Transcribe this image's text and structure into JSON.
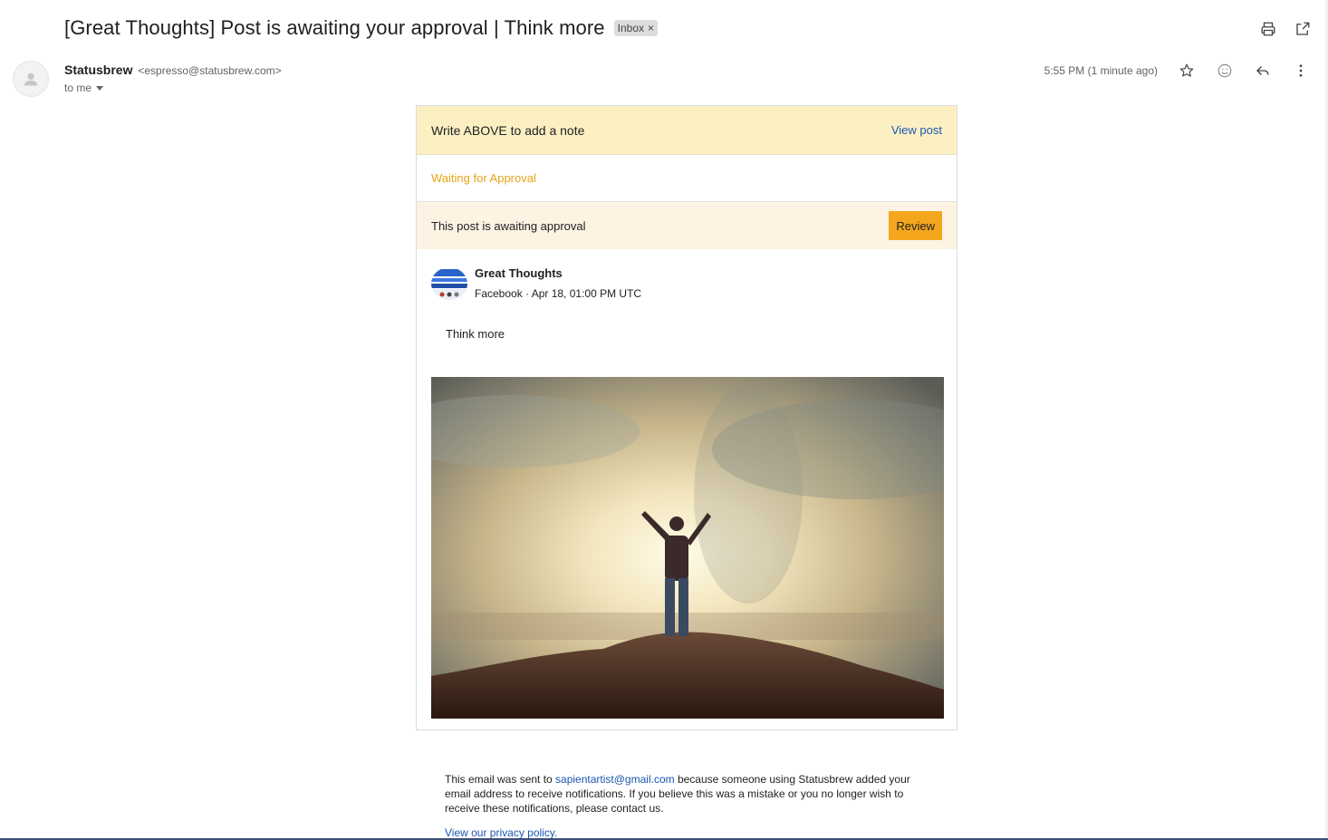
{
  "subject": "[Great Thoughts] Post is awaiting your approval | Think more",
  "label_chip": {
    "text": "Inbox",
    "remove": "×"
  },
  "header_icons": [
    "print-icon",
    "open-in-new-window-icon"
  ],
  "sender": {
    "name": "Statusbrew",
    "email": "<espresso@statusbrew.com>",
    "to": "to me"
  },
  "timestamp": "5:55 PM (1 minute ago)",
  "message_icons": [
    "star-icon",
    "emoji-icon",
    "reply-icon",
    "more-vertical-icon"
  ],
  "card": {
    "note": "Write ABOVE to add a note",
    "view_post": "View post",
    "status": "Waiting for Approval",
    "awaiting": "This post is awaiting approval",
    "review": "Review",
    "page_name": "Great Thoughts",
    "page_meta": "Facebook · Apr 18, 01:00 PM UTC",
    "post_text": "Think more"
  },
  "footer": {
    "prefix": "This email was sent to ",
    "email": "sapientartist@gmail.com",
    "suffix": " because someone using Statusbrew added your email address to receive notifications. If you believe this was a mistake or you no longer wish to receive these notifications, please contact us.",
    "privacy": "View our privacy policy."
  },
  "colors": {
    "note_bar": "#fcf0c3",
    "status_orange": "#e8a317",
    "await_bar": "#fdf3e3",
    "review_button": "#f4a61c",
    "link_blue": "#1a56b0"
  }
}
